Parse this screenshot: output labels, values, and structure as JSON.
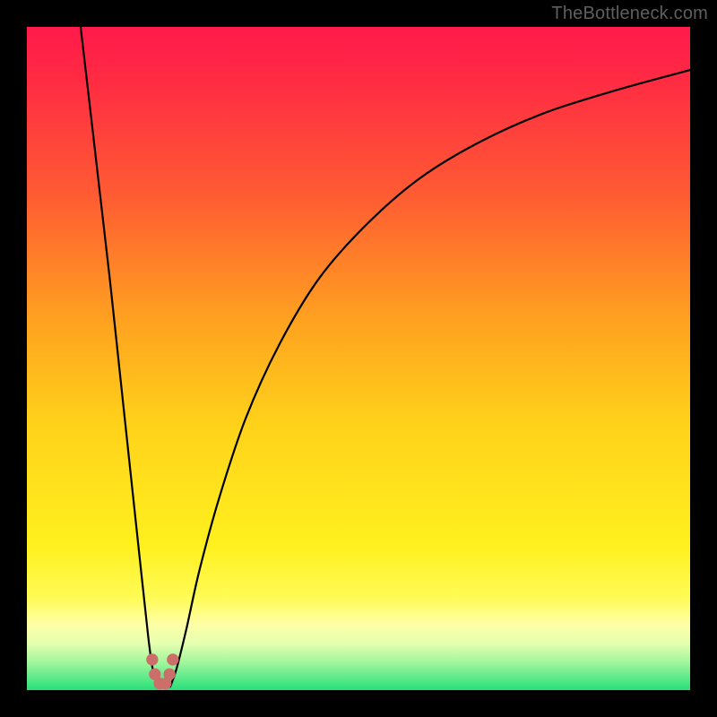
{
  "watermark": "TheBottleneck.com",
  "chart_data": {
    "type": "line",
    "title": "",
    "xlabel": "",
    "ylabel": "",
    "xlim": [
      0,
      100
    ],
    "ylim": [
      0,
      100
    ],
    "gradient_stops": [
      {
        "offset": 0,
        "color": "#ff1a4b"
      },
      {
        "offset": 0.08,
        "color": "#ff2b43"
      },
      {
        "offset": 0.25,
        "color": "#ff5a33"
      },
      {
        "offset": 0.45,
        "color": "#ffa41f"
      },
      {
        "offset": 0.6,
        "color": "#ffd21a"
      },
      {
        "offset": 0.78,
        "color": "#fff01e"
      },
      {
        "offset": 0.86,
        "color": "#fffb55"
      },
      {
        "offset": 0.9,
        "color": "#ffffa5"
      },
      {
        "offset": 0.93,
        "color": "#e4ffb0"
      },
      {
        "offset": 0.96,
        "color": "#9cf59b"
      },
      {
        "offset": 1.0,
        "color": "#27e07b"
      }
    ],
    "series": [
      {
        "name": "left-curve",
        "x": [
          8.1,
          9.5,
          11.0,
          12.5,
          14.0,
          15.5,
          17.0,
          18.3,
          19.0,
          19.8
        ],
        "y": [
          100,
          88,
          75,
          62,
          48,
          34,
          20,
          8,
          3,
          0.5
        ]
      },
      {
        "name": "right-curve",
        "x": [
          21.6,
          22.5,
          24.0,
          26.0,
          29.0,
          33.0,
          38.0,
          44.0,
          51.0,
          59.0,
          68.0,
          78.0,
          89.0,
          100.0
        ],
        "y": [
          0.5,
          3,
          9,
          18,
          29,
          41,
          52,
          62,
          70,
          77,
          82.5,
          87,
          90.5,
          93.5
        ]
      }
    ],
    "valley_markers": {
      "color": "#cc6f6b",
      "radius_pct": 0.9,
      "points": [
        {
          "x": 18.9,
          "y": 4.6
        },
        {
          "x": 19.3,
          "y": 2.4
        },
        {
          "x": 20.0,
          "y": 1.0
        },
        {
          "x": 20.9,
          "y": 1.0
        },
        {
          "x": 21.5,
          "y": 2.4
        },
        {
          "x": 22.0,
          "y": 4.6
        }
      ]
    }
  }
}
